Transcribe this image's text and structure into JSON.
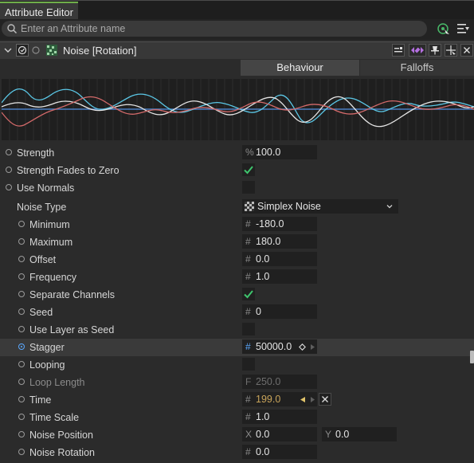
{
  "window": {
    "title": "Attribute Editor"
  },
  "search": {
    "placeholder": "Enter an Attribute name"
  },
  "object": {
    "name": "Noise [Rotation]"
  },
  "tabs": {
    "behaviour": "Behaviour",
    "falloffs": "Falloffs"
  },
  "colors": {
    "accent": "#5aa8ff",
    "check": "#3ec46d",
    "time_value": "#c8a45a",
    "keyframe": "#e0c36a"
  },
  "params": {
    "strength": {
      "label": "Strength",
      "prefix": "%",
      "value": "100.0"
    },
    "strength_fades": {
      "label": "Strength Fades to Zero",
      "checked": true
    },
    "use_normals": {
      "label": "Use Normals",
      "checked": false
    },
    "noise_type": {
      "label": "Noise Type",
      "value": "Simplex Noise"
    },
    "minimum": {
      "label": "Minimum",
      "prefix": "#",
      "value": "-180.0"
    },
    "maximum": {
      "label": "Maximum",
      "prefix": "#",
      "value": "180.0"
    },
    "offset": {
      "label": "Offset",
      "prefix": "#",
      "value": "0.0"
    },
    "frequency": {
      "label": "Frequency",
      "prefix": "#",
      "value": "1.0"
    },
    "separate_channels": {
      "label": "Separate Channels",
      "checked": true
    },
    "seed": {
      "label": "Seed",
      "prefix": "#",
      "value": "0"
    },
    "use_layer_seed": {
      "label": "Use Layer as Seed",
      "checked": false
    },
    "stagger": {
      "label": "Stagger",
      "prefix": "#",
      "value": "50000.0"
    },
    "looping": {
      "label": "Looping",
      "checked": false
    },
    "loop_length": {
      "label": "Loop Length",
      "prefix": "F",
      "value": "250.0"
    },
    "time": {
      "label": "Time",
      "prefix": "#",
      "value": "199.0"
    },
    "time_scale": {
      "label": "Time Scale",
      "prefix": "#",
      "value": "1.0"
    },
    "noise_position": {
      "label": "Noise Position",
      "x_prefix": "X",
      "x": "0.0",
      "y_prefix": "Y",
      "y": "0.0"
    },
    "noise_rotation": {
      "label": "Noise Rotation",
      "prefix": "#",
      "value": "0.0"
    }
  }
}
